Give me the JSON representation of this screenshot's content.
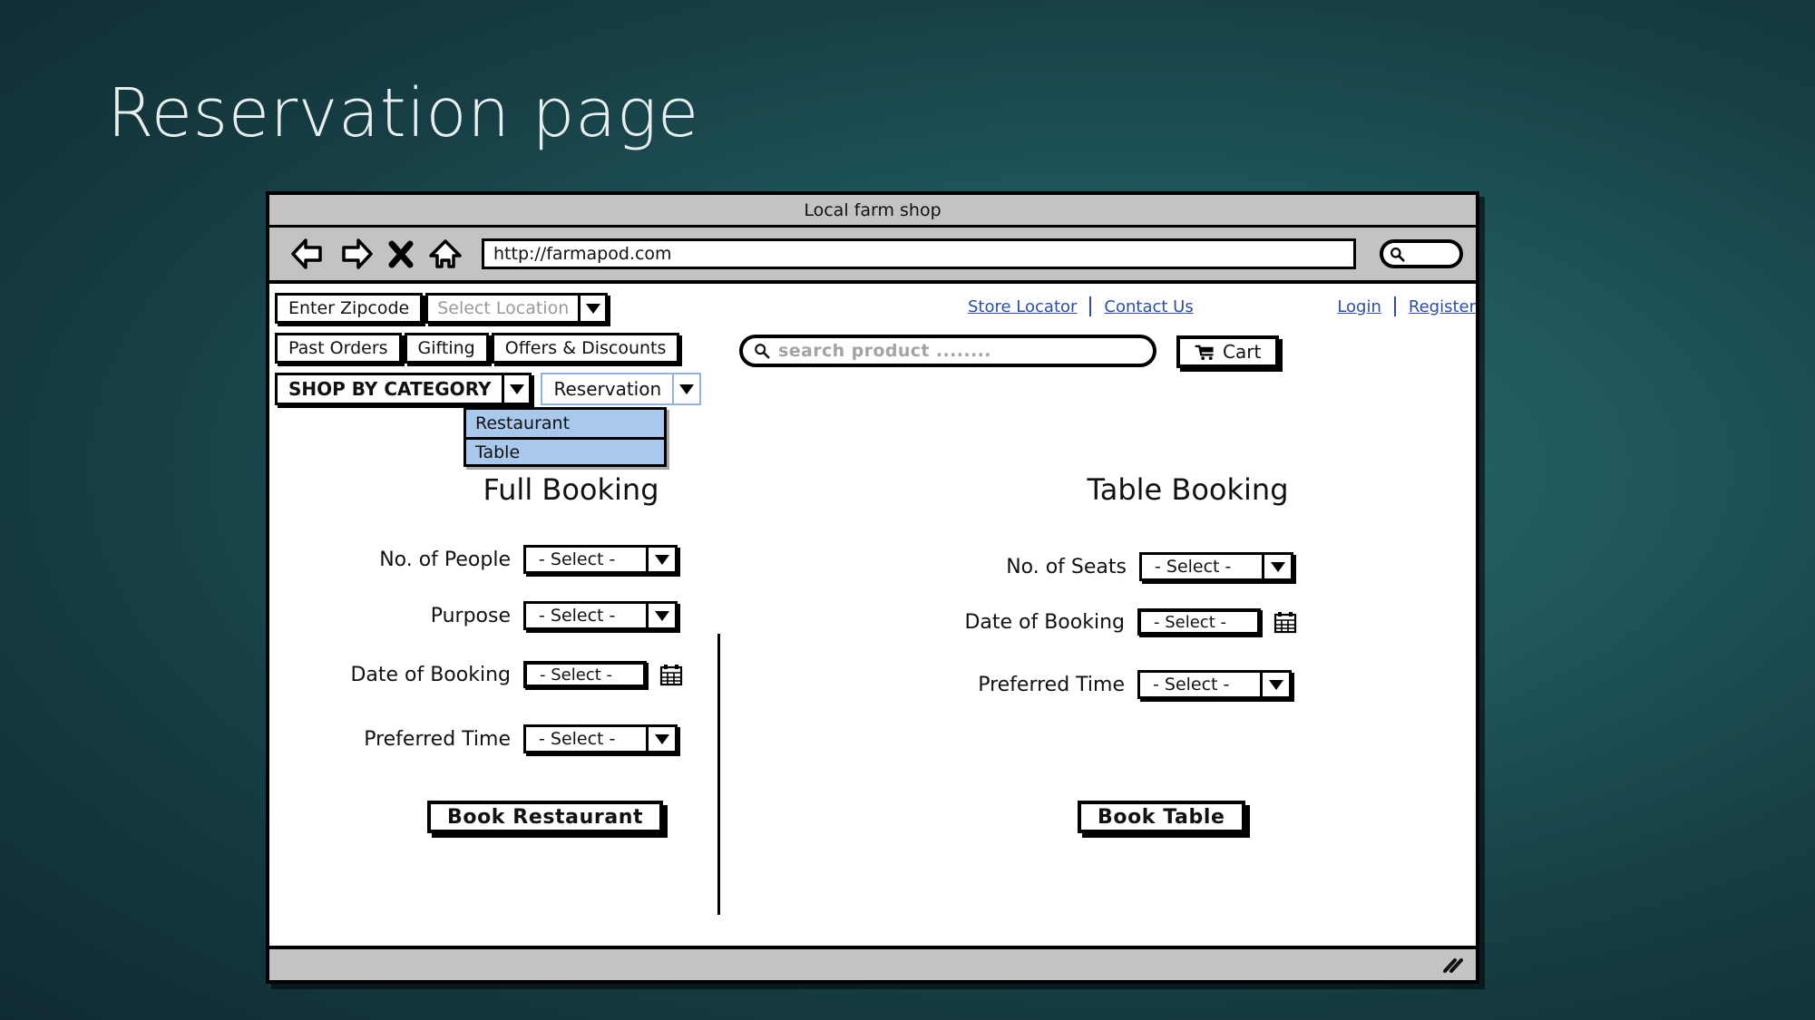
{
  "slide": {
    "title": "Reservation page",
    "background_color": "#1f565a",
    "title_color": "#e8eeee"
  },
  "browser": {
    "window_title": "Local farm shop",
    "url": "http://farmapod.com",
    "toolbar_icons": [
      "back-arrow-icon",
      "forward-arrow-icon",
      "stop-x-icon",
      "home-icon"
    ],
    "browser_search_icon": "search-icon"
  },
  "site_header": {
    "zipcode_field": "Enter Zipcode",
    "location_select": "Select Location",
    "nav_buttons": [
      "Past Orders",
      "Gifting",
      "Offers & Discounts"
    ],
    "top_links_left": [
      "Store Locator",
      "Contact Us"
    ],
    "top_links_right": [
      "Login",
      "Register"
    ],
    "search": {
      "placeholder": "search product ........",
      "icon": "search-icon"
    },
    "cart": {
      "label": "Cart",
      "icon": "shopping-cart-icon"
    },
    "category_select": "SHOP BY CATEGORY",
    "reservation_select": "Reservation",
    "reservation_menu": [
      "Restaurant",
      "Table"
    ],
    "menu_highlight_color": "#a9c9ec",
    "link_color": "#2b4f9e"
  },
  "full_booking": {
    "title": "Full Booking",
    "fields": [
      {
        "label": "No. of People",
        "value": "- Select -",
        "type": "select"
      },
      {
        "label": "Purpose",
        "value": "- Select -",
        "type": "select"
      },
      {
        "label": "Date of Booking",
        "value": "- Select -",
        "type": "date"
      },
      {
        "label": "Preferred Time",
        "value": "- Select -",
        "type": "select"
      }
    ],
    "submit_label": "Book Restaurant",
    "calendar_icon": "calendar-icon"
  },
  "table_booking": {
    "title": "Table Booking",
    "fields": [
      {
        "label": "No. of Seats",
        "value": "- Select -",
        "type": "select"
      },
      {
        "label": "Date of Booking",
        "value": "- Select -",
        "type": "date"
      },
      {
        "label": "Preferred Time",
        "value": "- Select -",
        "type": "select"
      }
    ],
    "submit_label": "Book Table",
    "calendar_icon": "calendar-icon"
  },
  "statusbar": {
    "resize_grip_icon": "resize-grip-icon"
  }
}
